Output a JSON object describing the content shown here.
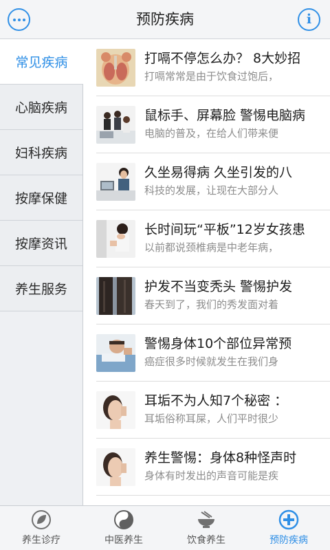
{
  "header": {
    "title": "预防疾病",
    "menu_icon": "more-dots-icon",
    "info_icon": "info-icon"
  },
  "sidebar": {
    "items": [
      {
        "label": "常见疾病",
        "active": true
      },
      {
        "label": "心脑疾病",
        "active": false
      },
      {
        "label": "妇科疾病",
        "active": false
      },
      {
        "label": "按摩保健",
        "active": false
      },
      {
        "label": "按摩资讯",
        "active": false
      },
      {
        "label": "养生服务",
        "active": false
      }
    ]
  },
  "articles": [
    {
      "title": "打嗝不停怎么办？ 8大妙招",
      "summary": "打嗝常常是由于饮食过饱后，",
      "thumb": "respiratory-diagram-thumbnail"
    },
    {
      "title": "鼠标手、屏幕脸 警惕电脑病",
      "summary": "电脑的普及，在给人们带来便",
      "thumb": "office-workers-thumbnail"
    },
    {
      "title": "久坐易得病 久坐引发的八",
      "summary": "科技的发展，让现在大部分人",
      "thumb": "woman-at-desk-thumbnail"
    },
    {
      "title": "长时间玩“平板”12岁女孩患",
      "summary": "以前都说颈椎病是中老年病，",
      "thumb": "neck-pain-thumbnail"
    },
    {
      "title": "护发不当变秃头 警惕护发",
      "summary": "春天到了，我们的秀发面对着",
      "thumb": "hair-thumbnail"
    },
    {
      "title": "警惕身体10个部位异常预",
      "summary": "癌症很多时候就发生在我们身",
      "thumb": "man-resting-thumbnail"
    },
    {
      "title": "耳垢不为人知7个秘密 ：",
      "summary": "耳垢俗称耳屎，人们平时很少",
      "thumb": "ear-listening-thumbnail"
    },
    {
      "title": "养生警惕：身体8种怪声时",
      "summary": "身体有时发出的声音可能是疾",
      "thumb": "ear-listening-thumbnail"
    }
  ],
  "tabbar": {
    "tabs": [
      {
        "label": "养生诊疗",
        "icon": "leaf-icon",
        "active": false
      },
      {
        "label": "中医养生",
        "icon": "yin-yang-icon",
        "active": false
      },
      {
        "label": "饮食养生",
        "icon": "food-bowl-icon",
        "active": false
      },
      {
        "label": "预防疾病",
        "icon": "plus-circle-icon",
        "active": true
      }
    ]
  },
  "colors": {
    "accent": "#2f8fe6",
    "header_bg": "#f4f5f7",
    "sidebar_bg": "#eceef1",
    "summary_text": "#8c8c8c"
  }
}
